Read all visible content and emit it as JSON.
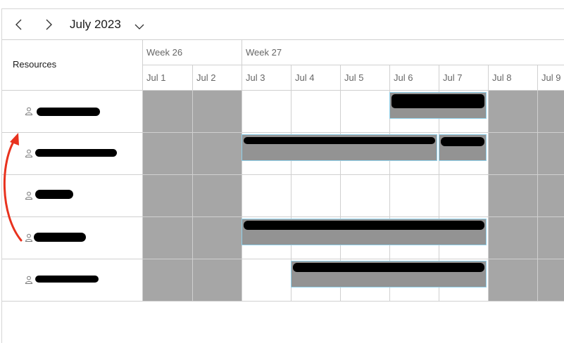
{
  "toolbar": {
    "title": "July 2023",
    "prev_icon": "chevron-left-icon",
    "next_icon": "chevron-right-icon",
    "dropdown_icon": "chevron-down-icon"
  },
  "header": {
    "resources_label": "Resources",
    "weeks": [
      "Week 26",
      "Week 27"
    ],
    "days": [
      "Jul 1",
      "Jul 2",
      "Jul 3",
      "Jul 4",
      "Jul 5",
      "Jul 6",
      "Jul 7",
      "Jul 8",
      "Jul 9"
    ]
  },
  "resources": [
    {
      "name": "",
      "icon": "person-icon"
    },
    {
      "name": "",
      "icon": "person-icon"
    },
    {
      "name": "",
      "icon": "person-icon"
    },
    {
      "name": "",
      "icon": "person-icon"
    },
    {
      "name": "",
      "icon": "person-icon"
    }
  ],
  "events": [
    {
      "resource": 0,
      "start": "Jul 6",
      "end": "Jul 7",
      "title": ""
    },
    {
      "resource": 1,
      "start": "Jul 3",
      "end": "Jul 6",
      "title": ""
    },
    {
      "resource": 1,
      "start": "Jul 7",
      "end": "Jul 7",
      "title": ""
    },
    {
      "resource": 3,
      "start": "Jul 3",
      "end": "Jul 7",
      "title": ""
    },
    {
      "resource": 4,
      "start": "Jul 4",
      "end": "Jul 7",
      "title": ""
    }
  ],
  "colors": {
    "weekend": "#a6a6a6",
    "event_fill": "#939393",
    "event_border": "#8fd0ea",
    "annotation_arrow": "#e8321e"
  }
}
